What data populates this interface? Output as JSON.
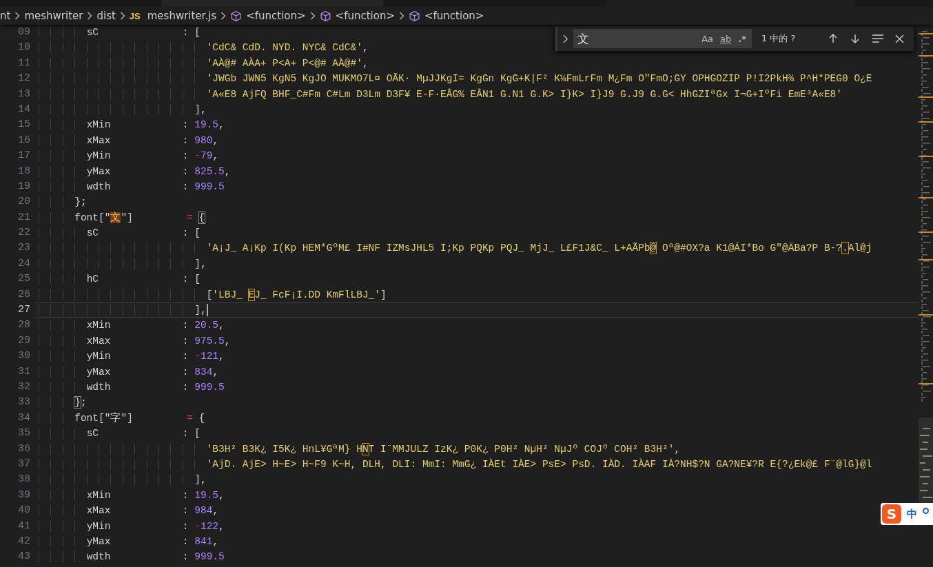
{
  "breadcrumbs": [
    {
      "kind": "folder",
      "label": "nt"
    },
    {
      "kind": "folder",
      "label": "meshwriter"
    },
    {
      "kind": "folder",
      "label": "dist"
    },
    {
      "kind": "file",
      "badge": "JS",
      "label": "meshwriter.js"
    },
    {
      "kind": "symbol",
      "label": "<function>"
    },
    {
      "kind": "symbol",
      "label": "<function>"
    },
    {
      "kind": "symbol",
      "label": "<function>"
    }
  ],
  "lines": [
    {
      "num": "09",
      "current": false,
      "tokens": [
        {
          "kind": "plain",
          "text": "        sC              : ["
        }
      ]
    },
    {
      "num": "10",
      "current": false,
      "tokens": [
        {
          "kind": "string",
          "text": "                            'CdC& CdD. NYD. NYC& CdC&'"
        },
        {
          "kind": "plain",
          "text": ","
        }
      ]
    },
    {
      "num": "11",
      "current": false,
      "tokens": [
        {
          "kind": "string",
          "text": "                            'AÀ@# AÀA+ P<A+ P<@# AÀ@#'"
        },
        {
          "kind": "plain",
          "text": ","
        }
      ]
    },
    {
      "num": "12",
      "current": false,
      "tokens": [
        {
          "kind": "string",
          "text": "                            'JWGb JWN5 KgN5 KgJO MUKMO7L¤ OÃK· MµJJKgI= KgGn KgG+K|F² K¼FmLrFm M¿Fm O\"FmO;GY OPHGOZIP P!I2PkH¾ P^H*PEG0 O¿E"
        }
      ]
    },
    {
      "num": "13",
      "current": false,
      "tokens": [
        {
          "kind": "string",
          "text": "                            'A«E8 AjFQ BHF_C#Fm C#Lm D3Lm D3F¥ E-F·EÂG% EÂN1 G.N1 G.K> I}K> I}J9 G.J9 G.G< HhGZIªGx I¬G+IºFi EmE³A«E8'"
        }
      ]
    },
    {
      "num": "14",
      "current": false,
      "tokens": [
        {
          "kind": "plain",
          "text": "                          ],"
        }
      ]
    },
    {
      "num": "15",
      "current": false,
      "tokens": [
        {
          "kind": "plain",
          "text": "        xMin            : "
        },
        {
          "kind": "number",
          "text": "19.5"
        },
        {
          "kind": "plain",
          "text": ","
        }
      ]
    },
    {
      "num": "16",
      "current": false,
      "tokens": [
        {
          "kind": "plain",
          "text": "        xMax            : "
        },
        {
          "kind": "number",
          "text": "980"
        },
        {
          "kind": "plain",
          "text": ","
        }
      ]
    },
    {
      "num": "17",
      "current": false,
      "tokens": [
        {
          "kind": "plain",
          "text": "        yMin            : "
        },
        {
          "kind": "operator",
          "text": "-"
        },
        {
          "kind": "number",
          "text": "79"
        },
        {
          "kind": "plain",
          "text": ","
        }
      ]
    },
    {
      "num": "18",
      "current": false,
      "tokens": [
        {
          "kind": "plain",
          "text": "        yMax            : "
        },
        {
          "kind": "number",
          "text": "825.5"
        },
        {
          "kind": "plain",
          "text": ","
        }
      ]
    },
    {
      "num": "19",
      "current": false,
      "tokens": [
        {
          "kind": "plain",
          "text": "        wdth            : "
        },
        {
          "kind": "number",
          "text": "999.5"
        }
      ]
    },
    {
      "num": "20",
      "current": false,
      "tokens": [
        {
          "kind": "plain",
          "text": "      };"
        }
      ]
    },
    {
      "num": "21",
      "current": false,
      "tokens": [
        {
          "kind": "plain",
          "text": "      font[\""
        },
        {
          "kind": "match",
          "text": "文"
        },
        {
          "kind": "plain",
          "text": "\"]         "
        },
        {
          "kind": "operator",
          "text": "= "
        },
        {
          "kind": "bracket",
          "text": "{"
        }
      ]
    },
    {
      "num": "22",
      "current": false,
      "tokens": [
        {
          "kind": "plain",
          "text": "        sC              : ["
        }
      ]
    },
    {
      "num": "23",
      "current": false,
      "tokens": [
        {
          "kind": "string",
          "text": "                            'A¡J_ A¡Kp I(Kp HEM*GºM£ I#NF IZMsJHL5 I;Kp PQKp PQJ_ MjJ_ L£F1J&C_ L+AÃPb"
        },
        {
          "kind": "ambiguous",
          "text": "@"
        },
        {
          "kind": "string",
          "text": " Oª@#OX?a K1@ÁI*Bo G\"@ÄBa?P B-?"
        },
        {
          "kind": "ambiguous",
          "text": "."
        },
        {
          "kind": "string",
          "text": "Al@j"
        }
      ]
    },
    {
      "num": "24",
      "current": false,
      "tokens": [
        {
          "kind": "plain",
          "text": "                          ],"
        }
      ]
    },
    {
      "num": "25",
      "current": false,
      "tokens": [
        {
          "kind": "plain",
          "text": "        hC              : ["
        }
      ]
    },
    {
      "num": "26",
      "current": false,
      "tokens": [
        {
          "kind": "plain",
          "text": "                            ["
        },
        {
          "kind": "string",
          "text": "'LBJ_ "
        },
        {
          "kind": "ambiguous",
          "text": "E"
        },
        {
          "kind": "string",
          "text": "J_ FcF¡I.DD KmFlLBJ_'"
        },
        {
          "kind": "plain",
          "text": "]"
        }
      ]
    },
    {
      "num": "27",
      "current": true,
      "tokens": [
        {
          "kind": "plain",
          "text": "                          ],"
        }
      ]
    },
    {
      "num": "28",
      "current": false,
      "tokens": [
        {
          "kind": "plain",
          "text": "        xMin            : "
        },
        {
          "kind": "number",
          "text": "20.5"
        },
        {
          "kind": "plain",
          "text": ","
        }
      ]
    },
    {
      "num": "29",
      "current": false,
      "tokens": [
        {
          "kind": "plain",
          "text": "        xMax            : "
        },
        {
          "kind": "number",
          "text": "975.5"
        },
        {
          "kind": "plain",
          "text": ","
        }
      ]
    },
    {
      "num": "30",
      "current": false,
      "tokens": [
        {
          "kind": "plain",
          "text": "        yMin            : "
        },
        {
          "kind": "operator",
          "text": "-"
        },
        {
          "kind": "number",
          "text": "121"
        },
        {
          "kind": "plain",
          "text": ","
        }
      ]
    },
    {
      "num": "31",
      "current": false,
      "tokens": [
        {
          "kind": "plain",
          "text": "        yMax            : "
        },
        {
          "kind": "number",
          "text": "834"
        },
        {
          "kind": "plain",
          "text": ","
        }
      ]
    },
    {
      "num": "32",
      "current": false,
      "tokens": [
        {
          "kind": "plain",
          "text": "        wdth            : "
        },
        {
          "kind": "number",
          "text": "999.5"
        }
      ]
    },
    {
      "num": "33",
      "current": false,
      "tokens": [
        {
          "kind": "bracket",
          "text": "      }"
        },
        {
          "kind": "plain",
          "text": ";"
        }
      ]
    },
    {
      "num": "34",
      "current": false,
      "tokens": [
        {
          "kind": "plain",
          "text": "      font[\"字\"]         "
        },
        {
          "kind": "operator",
          "text": "="
        },
        {
          "kind": "plain",
          "text": " {"
        }
      ]
    },
    {
      "num": "35",
      "current": false,
      "tokens": [
        {
          "kind": "plain",
          "text": "        sC              : ["
        }
      ]
    },
    {
      "num": "36",
      "current": false,
      "tokens": [
        {
          "kind": "string",
          "text": "                            'B3H² B3K¿ I5K¿ HnL¥GªM} H"
        },
        {
          "kind": "ambiguous",
          "text": "N"
        },
        {
          "kind": "string",
          "text": "T I¨MMJULZ IzK¿ P0K¿ P0H² NµH² NµJº COJº COH² B3H²'"
        },
        {
          "kind": "plain",
          "text": ","
        }
      ]
    },
    {
      "num": "37",
      "current": false,
      "tokens": [
        {
          "kind": "string",
          "text": "                            'AjD. AjE> H~E> H~F9 K~H, DLH, DLI: MmI: MmG¿ IÀEt IÀE> PsE> PsD. IÀD. IÀAF IÀ?NH$?N GA?NE¥?R E{?¿Ek@£ F¨@lG}@l"
        }
      ]
    },
    {
      "num": "38",
      "current": false,
      "tokens": [
        {
          "kind": "plain",
          "text": "                          ],"
        }
      ]
    },
    {
      "num": "39",
      "current": false,
      "tokens": [
        {
          "kind": "plain",
          "text": "        xMin            : "
        },
        {
          "kind": "number",
          "text": "19.5"
        },
        {
          "kind": "plain",
          "text": ","
        }
      ]
    },
    {
      "num": "40",
      "current": false,
      "tokens": [
        {
          "kind": "plain",
          "text": "        xMax            : "
        },
        {
          "kind": "number",
          "text": "984"
        },
        {
          "kind": "plain",
          "text": ","
        }
      ]
    },
    {
      "num": "41",
      "current": false,
      "tokens": [
        {
          "kind": "plain",
          "text": "        yMin            : "
        },
        {
          "kind": "operator",
          "text": "-"
        },
        {
          "kind": "number",
          "text": "122"
        },
        {
          "kind": "plain",
          "text": ","
        }
      ]
    },
    {
      "num": "42",
      "current": false,
      "tokens": [
        {
          "kind": "plain",
          "text": "        yMax            : "
        },
        {
          "kind": "number",
          "text": "841"
        },
        {
          "kind": "plain",
          "text": ","
        }
      ]
    },
    {
      "num": "43",
      "current": false,
      "tokens": [
        {
          "kind": "plain",
          "text": "        wdth            : "
        },
        {
          "kind": "number",
          "text": "999.5"
        }
      ]
    }
  ],
  "find": {
    "value": "文",
    "options": [
      {
        "label": "Aa",
        "on": false
      },
      {
        "label": "ab",
        "on": false
      },
      {
        "label": ".*",
        "on": false
      }
    ],
    "result": "1 中的 ?"
  },
  "ime": {
    "logo": "S",
    "label": "中"
  }
}
